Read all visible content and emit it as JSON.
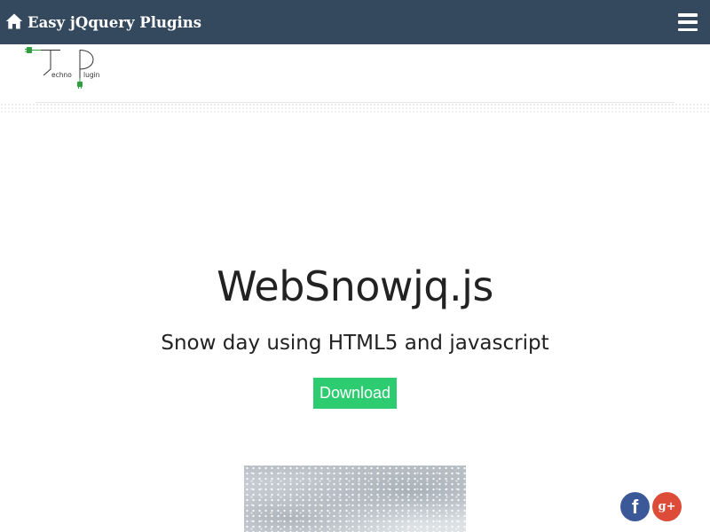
{
  "header": {
    "brand_label": "Easy jQquery Plugins",
    "home_icon": "home-icon",
    "menu_icon": "hamburger-menu-icon",
    "background_color": "#34495e"
  },
  "logo": {
    "line1": "echno",
    "line2": "lugin",
    "accent_color": "#2e9e3e"
  },
  "hero": {
    "title": "WebSnowjq.js",
    "subtitle": "Snow day using HTML5 and javascript",
    "download_label": "Download",
    "download_color": "#2ecc71"
  },
  "preview": {
    "icon": "snowy-forest-image"
  },
  "social": {
    "facebook_label": "f",
    "google_plus_label": "g+",
    "facebook_color": "#3b5998",
    "google_plus_color": "#dd4b39"
  }
}
